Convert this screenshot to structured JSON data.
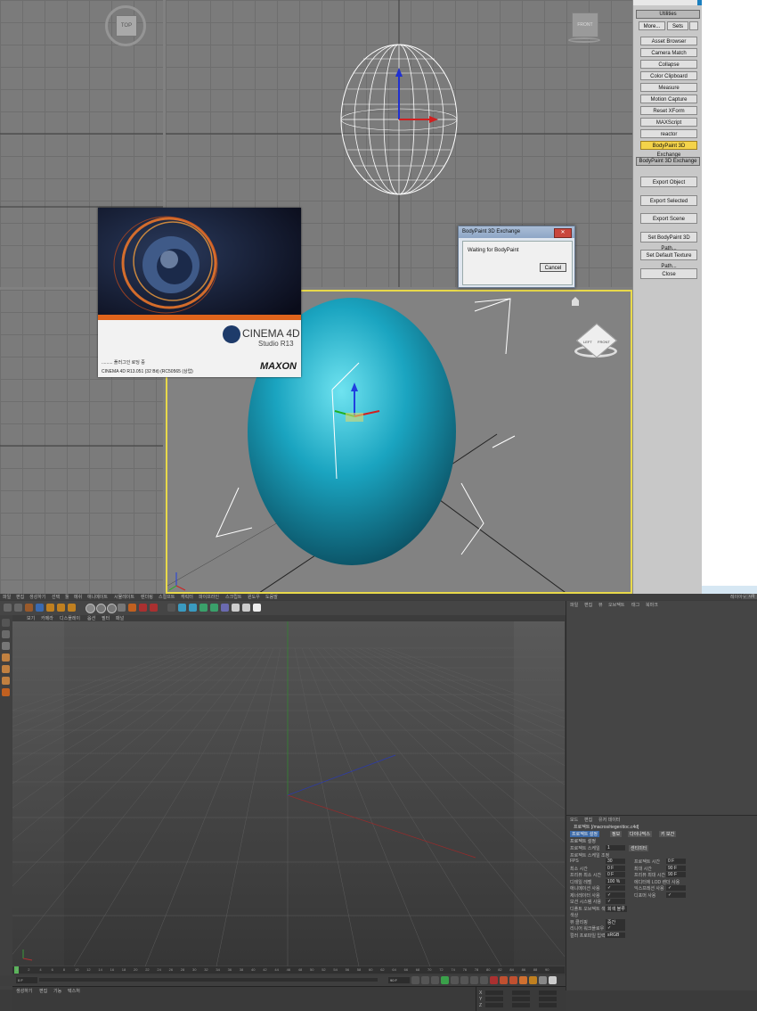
{
  "max": {
    "viewport_labels": {
      "top": "TOP",
      "front": "FRONT"
    },
    "viewcube": {
      "left": "LEFT",
      "front": "FRONT"
    },
    "panel": {
      "title": "Utilities",
      "more_label": "More...",
      "sets_label": "Sets",
      "utilities": [
        "Asset Browser",
        "Camera Match",
        "Collapse",
        "Color Clipboard",
        "Measure",
        "Motion Capture",
        "Reset XForm",
        "MAXScript",
        "reactor",
        "BodyPaint 3D Exchange"
      ],
      "selected_index": 9,
      "rollout_title": "BodyPaint 3D Exchange",
      "exchange_buttons": [
        "Export Object",
        "Export Selected",
        "Export Scene",
        "Set BodyPaint 3D Path...",
        "Set Default Texture Path...",
        "Close"
      ]
    },
    "dialog": {
      "title": "BodyPaint 3D Exchange",
      "message": "Waiting for BodyPaint",
      "cancel_label": "Cancel",
      "close_glyph": "✕"
    }
  },
  "splash": {
    "brand": "CINEMA 4D",
    "edition": "Studio R13",
    "status": "......... 플러그인 로딩 중",
    "version": "CINEMA 4D R13.051 (32 Bit)  (RC50565 (상업)",
    "company": "MAXON"
  },
  "c4d": {
    "menu": [
      "파일",
      "편집",
      "생성하기",
      "선택",
      "툴",
      "메쉬",
      "애니메이트",
      "시뮬레이트",
      "렌더링",
      "스컬프트",
      "캐릭터",
      "파이프라인",
      "스크립트",
      "윈도우",
      "도움말"
    ],
    "viewport_menu": [
      "보기",
      "카메라",
      "디스플레이",
      "옵션",
      "필터",
      "패널"
    ],
    "viewport_label": "원근",
    "layout_label": "레이아웃",
    "layout_value": "시작",
    "object_manager_menu": [
      "파일",
      "편집",
      "뷰",
      "오브젝트",
      "태그",
      "북마크"
    ],
    "attr_menu": [
      "모드",
      "편집",
      "유저 데이터"
    ],
    "attr_title": "프로젝트 [/macros/rieger/doc.c4d]",
    "attr_tabs": [
      "프로젝트 설정",
      "정보",
      "다이나믹스",
      "키 보간"
    ],
    "attr_section": "프로젝트 설정",
    "attr_rows": [
      {
        "label": "프로젝트 스케일",
        "value": "1",
        "unit": "센티미터"
      },
      {
        "label": "프로젝트 스케일 조정",
        "value": ""
      },
      {
        "label": "FPS",
        "value": "30",
        "label2": "프로젝트 시간",
        "value2": "0 F"
      },
      {
        "label": "최소 시간",
        "value": "0 F",
        "label2": "최대 시간",
        "value2": "90 F"
      },
      {
        "label": "프리뷰 최소 시간",
        "value": "0 F",
        "label2": "프리뷰 최대 시간",
        "value2": "90 F"
      },
      {
        "label": "디테일 레벨",
        "value": "100 %",
        "label2": "에디터에 LOD 렌더 사용",
        "value2": ""
      },
      {
        "label": "애니메이션 사용",
        "value": "✓",
        "label2": "익스프레션 사용",
        "value2": "✓"
      },
      {
        "label": "제너레이터 사용",
        "value": "✓",
        "label2": "디포머 사용",
        "value2": "✓"
      },
      {
        "label": "모션 시스템 사용",
        "value": "✓"
      },
      {
        "label": "디폴트 오브젝트 색상",
        "value": "회색 블루"
      },
      {
        "label": "색상",
        "value": ""
      },
      {
        "label": "뷰 클리핑",
        "value": "중간"
      },
      {
        "label": "리니어 워크플로우",
        "value": "✓"
      },
      {
        "label": "컬러 프로파일 입력",
        "value": "sRGB"
      }
    ],
    "timeline_ticks": [
      "0",
      "2",
      "4",
      "6",
      "8",
      "10",
      "12",
      "14",
      "16",
      "18",
      "20",
      "22",
      "24",
      "26",
      "28",
      "30",
      "32",
      "34",
      "36",
      "38",
      "40",
      "42",
      "44",
      "46",
      "48",
      "50",
      "52",
      "54",
      "56",
      "58",
      "60",
      "62",
      "64",
      "66",
      "68",
      "70",
      "72",
      "74",
      "76",
      "78",
      "80",
      "82",
      "84",
      "86",
      "88",
      "90"
    ],
    "time_start": "0 F",
    "time_end": "90 F",
    "material_menu": [
      "생성하기",
      "편집",
      "기능",
      "텍스처"
    ],
    "coord_labels": [
      "X",
      "Y",
      "Z"
    ]
  }
}
